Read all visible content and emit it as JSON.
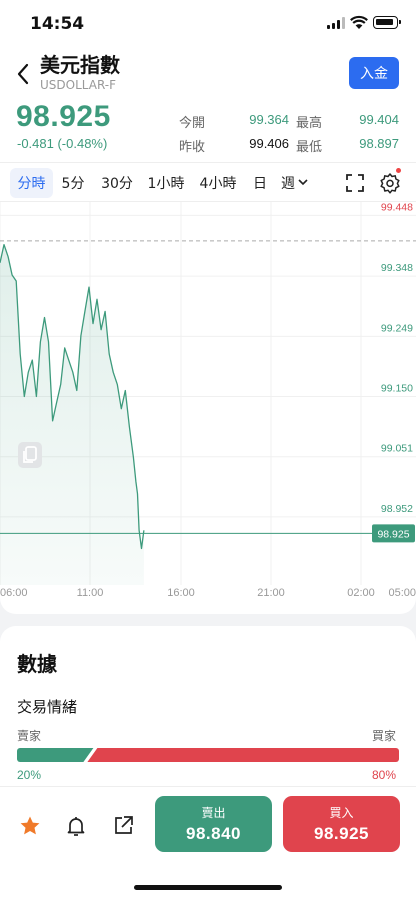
{
  "status": {
    "time": "14:54"
  },
  "header": {
    "title": "美元指數",
    "subtitle": "USDOLLAR-F",
    "deposit_label": "入金"
  },
  "quote": {
    "price": "98.925",
    "change": "-0.481 (-0.48%)",
    "stats": [
      {
        "label": "今開",
        "value": "99.364",
        "color": "#3d9a7c"
      },
      {
        "label": "最高",
        "value": "99.404",
        "color": "#3d9a7c"
      },
      {
        "label": "昨收",
        "value": "99.406",
        "color": "#111111"
      },
      {
        "label": "最低",
        "value": "98.897",
        "color": "#3d9a7c"
      }
    ]
  },
  "tabs": [
    "分時",
    "5分",
    "30分",
    "1小時",
    "4小時",
    "日",
    "週"
  ],
  "active_tab": "分時",
  "chart_data": {
    "type": "line",
    "x_ticks": [
      "06:00",
      "11:00",
      "16:00",
      "21:00",
      "02:00",
      "05:00"
    ],
    "y_ticks": [
      "99.448",
      "99.348",
      "99.249",
      "99.150",
      "99.051",
      "98.952"
    ],
    "ylim": [
      98.84,
      99.47
    ],
    "prev_close_line": 99.406,
    "current_price": 98.925,
    "current_price_label": "98.925",
    "series": [
      {
        "times": [
          6.0,
          6.25,
          6.5,
          6.75,
          7.0,
          7.25,
          7.5,
          7.75,
          8.0,
          8.25,
          8.5,
          8.75,
          9.0,
          9.25,
          9.5,
          9.75,
          10.0,
          10.25,
          10.5,
          10.75,
          11.0,
          11.25,
          11.5,
          11.75,
          12.0,
          12.25,
          12.5,
          12.75,
          13.0,
          13.25,
          13.5,
          13.75,
          14.0,
          14.1,
          14.25,
          14.4,
          14.5,
          14.6,
          14.75,
          14.9
        ],
        "values": [
          99.37,
          99.4,
          99.38,
          99.35,
          99.34,
          99.22,
          99.15,
          99.19,
          99.21,
          99.15,
          99.24,
          99.28,
          99.24,
          99.11,
          99.14,
          99.17,
          99.23,
          99.21,
          99.19,
          99.16,
          99.25,
          99.29,
          99.33,
          99.27,
          99.31,
          99.26,
          99.29,
          99.22,
          99.19,
          99.17,
          99.13,
          99.16,
          99.1,
          99.08,
          99.05,
          99.01,
          98.99,
          98.93,
          98.9,
          98.93
        ]
      }
    ],
    "price_color": "#3d9a7c",
    "ref_color": "#e0444d"
  },
  "data_card": {
    "title": "數據",
    "sentiment_title": "交易情緒",
    "seller_label": "賣家",
    "buyer_label": "買家",
    "seller_pct": 20,
    "buyer_pct": 80,
    "seller_text": "20%",
    "buyer_text": "80%"
  },
  "trade": {
    "sell_label": "賣出",
    "sell_price": "98.840",
    "buy_label": "買入",
    "buy_price": "98.925"
  },
  "colors": {
    "up": "#3d9a7c",
    "down": "#e0444d",
    "accent": "#2c6cf0",
    "star": "#f07a2a"
  }
}
